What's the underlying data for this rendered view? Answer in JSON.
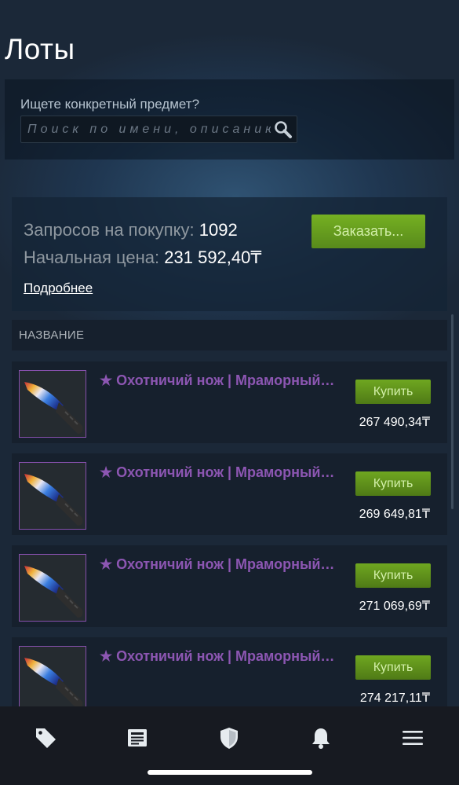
{
  "page": {
    "title": "Лоты"
  },
  "search": {
    "label": "Ищете конкретный предмет?",
    "placeholder": "Поиск по имени, описанию",
    "icon": "magnifier-icon"
  },
  "buy_orders": {
    "requests_label": "Запросов на покупку:",
    "requests_value": "1092",
    "start_price_label": "Начальная цена:",
    "start_price_value": "231 592,40₸",
    "more_link": "Подробнее",
    "order_button": "Заказать..."
  },
  "table": {
    "column_header": "НАЗВАНИЕ"
  },
  "listings": [
    {
      "name": "★ Охотничий нож | Мраморный узор",
      "buy_label": "Купить",
      "price": "267 490,34₸"
    },
    {
      "name": "★ Охотничий нож | Мраморный узор",
      "buy_label": "Купить",
      "price": "269 649,81₸"
    },
    {
      "name": "★ Охотничий нож | Мраморный узор",
      "buy_label": "Купить",
      "price": "271 069,69₸"
    },
    {
      "name": "★ Охотничий нож | Мраморный узор",
      "buy_label": "Купить",
      "price": "274 217,11₸"
    }
  ],
  "tabbar": {
    "items": [
      "tag-icon",
      "news-icon",
      "shield-icon",
      "bell-icon",
      "menu-icon"
    ]
  },
  "colors": {
    "background": "#1b2838",
    "accent_green": "#75b022",
    "item_name_purple": "#8c56b2"
  }
}
